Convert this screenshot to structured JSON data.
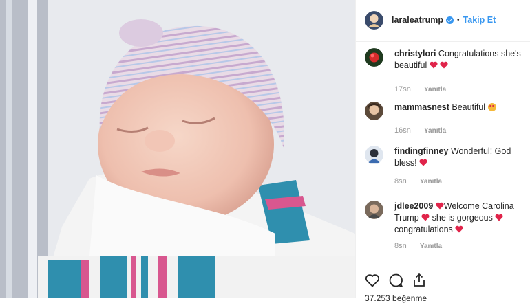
{
  "post": {
    "author": "laraleatrump",
    "follow_label": "Takip Et",
    "separator": "•",
    "likes_text": "37.253 beğenme"
  },
  "comments": [
    {
      "user": "christylori",
      "text": "Congratulations she's beautiful",
      "hearts": 2,
      "time": "17sn",
      "reply": "Yanıtla"
    },
    {
      "user": "mammasnest",
      "text": "Beautiful",
      "emoji": "heart-eyes-emoji",
      "time": "16sn",
      "reply": "Yanıtla"
    },
    {
      "user": "findingfinney",
      "text": "Wonderful! God bless!",
      "hearts": 1,
      "time": "8sn",
      "reply": "Yanıtla"
    },
    {
      "user": "jdlee2009",
      "text_parts": [
        "Welcome Carolina Trump",
        "she is gorgeous",
        "congratulations"
      ],
      "time": "8sn",
      "reply": "Yanıtla"
    }
  ],
  "icons": [
    "like-heart-icon",
    "comment-icon",
    "share-icon",
    "verified-badge-icon"
  ],
  "colors": {
    "link": "#3897f0",
    "heart": "#ed4956",
    "meta": "#999999",
    "border": "#efefef"
  }
}
